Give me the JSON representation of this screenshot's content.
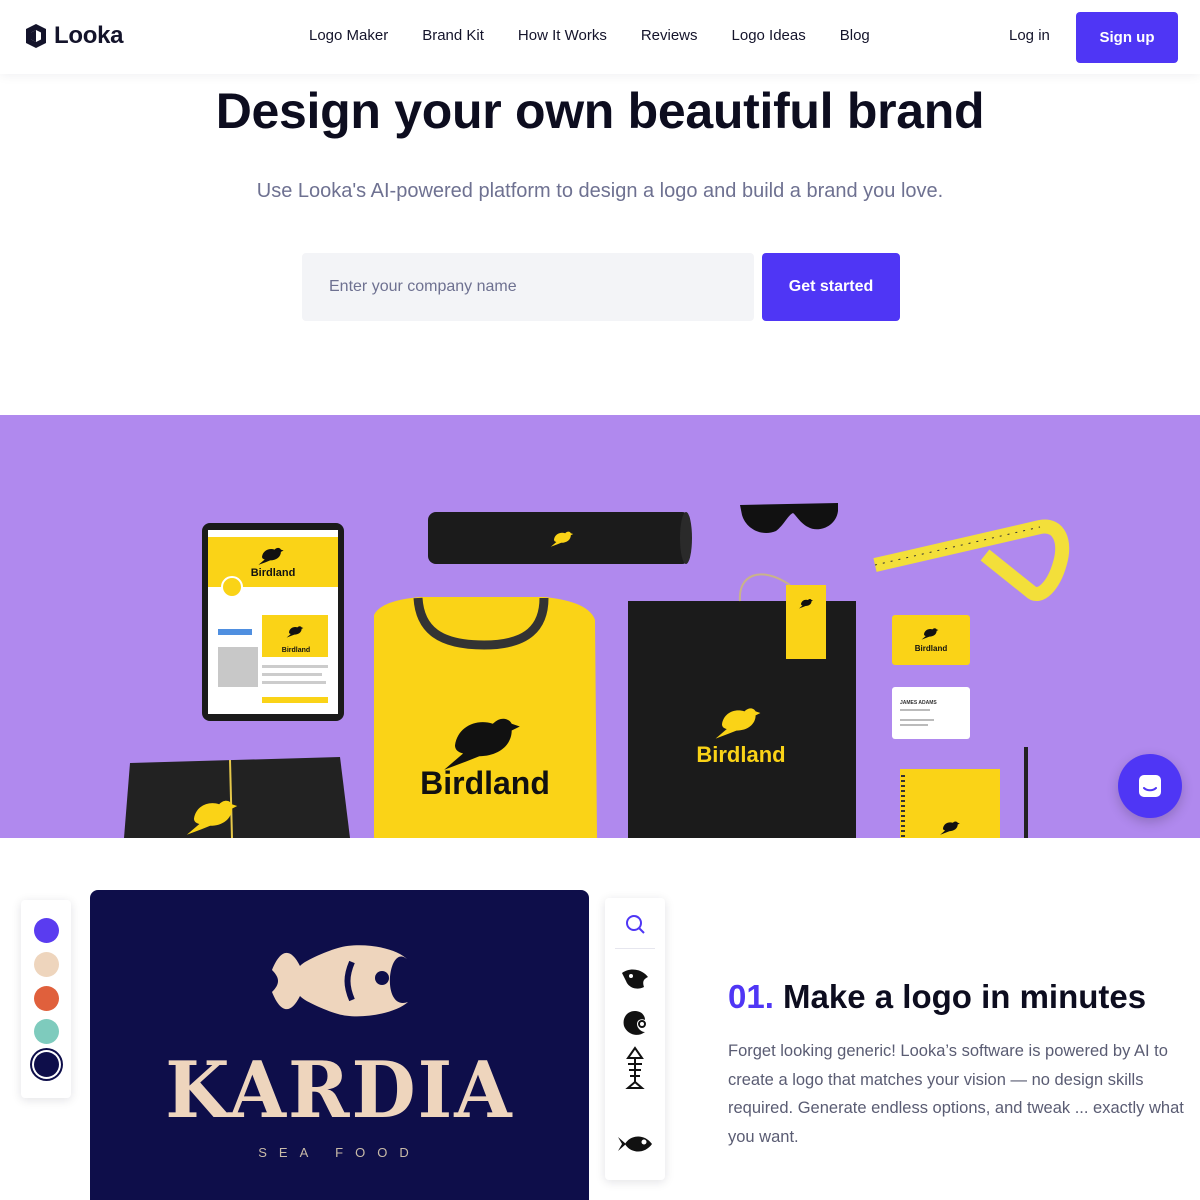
{
  "nav": {
    "brand": "Looka",
    "links": [
      "Logo Maker",
      "Brand Kit",
      "How It Works",
      "Reviews",
      "Logo Ideas",
      "Blog"
    ],
    "login": "Log in",
    "signup": "Sign up"
  },
  "hero": {
    "title": "Design your own beautiful brand",
    "subtitle": "Use Looka's AI-powered platform to design a logo and build a brand you love.",
    "input_placeholder": "Enter your company name",
    "cta": "Get started"
  },
  "banner": {
    "brand_name": "Birdland",
    "card_name": "JAMES ADAMS",
    "background": "#b089ee",
    "accent": "#fad317"
  },
  "feature": {
    "swatches": [
      "#5a3cf0",
      "#eed5bd",
      "#e0603c",
      "#7ecbbd",
      "#0e0e4a"
    ],
    "logo_word": "KARDIA",
    "logo_sub": "SEA FOOD",
    "icons": [
      "search-icon",
      "fish-head-icon",
      "fish-swirl-icon",
      "fish-skeleton-icon",
      "fish-icon"
    ],
    "step_number": "01.",
    "step_title": "Make a logo in minutes",
    "step_body": "Forget looking generic! Looka’s software is powered by AI to create a logo that matches your vision — no design skills required. Generate endless options, and tweak ... exactly what you want."
  },
  "colors": {
    "primary": "#4f36f5",
    "navy": "#0e0e4a"
  }
}
